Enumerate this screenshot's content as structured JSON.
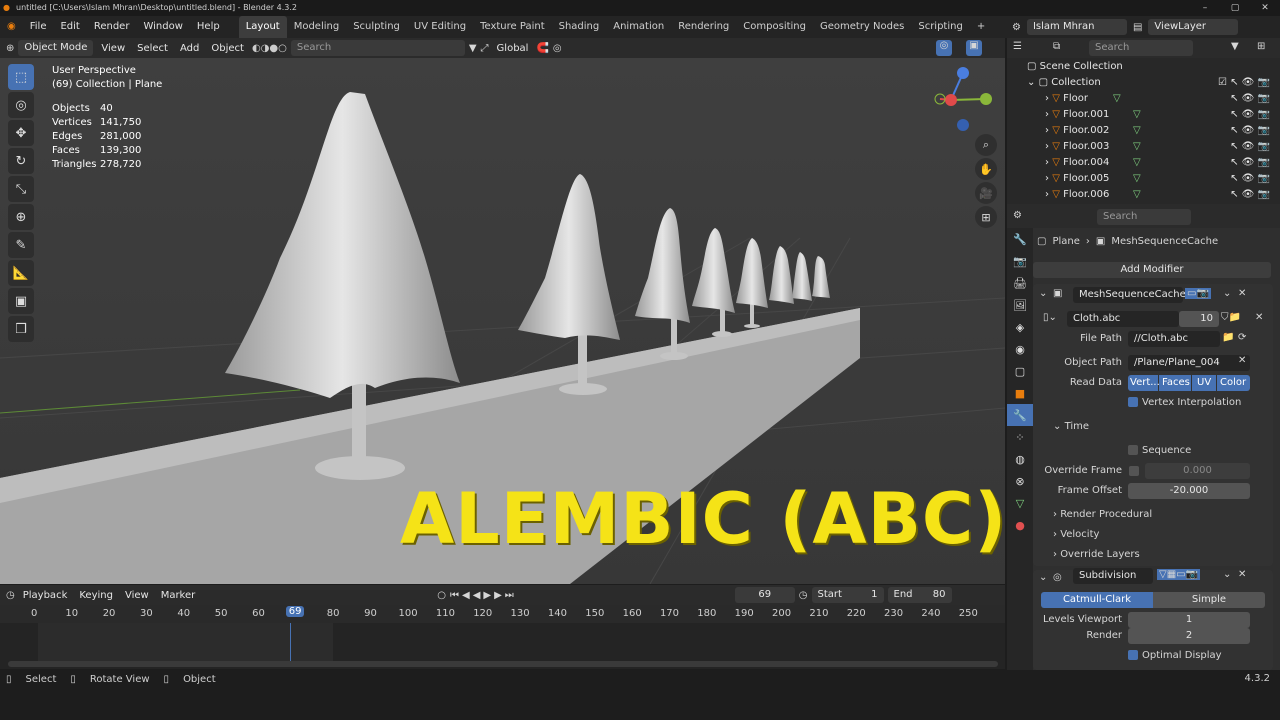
{
  "window": {
    "title": "untitled [C:\\Users\\Islam Mhran\\Desktop\\untitled.blend] - Blender 4.3.2"
  },
  "menu": {
    "items": [
      "File",
      "Edit",
      "Render",
      "Window",
      "Help"
    ]
  },
  "workspaces": [
    "Layout",
    "Modeling",
    "Sculpting",
    "UV Editing",
    "Texture Paint",
    "Shading",
    "Animation",
    "Rendering",
    "Compositing",
    "Geometry Nodes",
    "Scripting"
  ],
  "active_workspace": "Layout",
  "topright": {
    "user": "Islam Mhran",
    "viewlayer": "ViewLayer"
  },
  "viewport_header": {
    "mode": "Object Mode",
    "view": "View",
    "select": "Select",
    "add": "Add",
    "object": "Object",
    "search_placeholder": "Search",
    "orientation": "Global"
  },
  "viewport": {
    "perspective": "User Perspective",
    "collection_line": "(69) Collection | Plane",
    "stats": [
      {
        "k": "Objects",
        "v": "40"
      },
      {
        "k": "Vertices",
        "v": "141,750"
      },
      {
        "k": "Edges",
        "v": "281,000"
      },
      {
        "k": "Faces",
        "v": "139,300"
      },
      {
        "k": "Triangles",
        "v": "278,720"
      }
    ],
    "overlay_title": "ALEMBIC (ABC)"
  },
  "timeline_header": {
    "playback": "Playback",
    "keying": "Keying",
    "view": "View",
    "marker": "Marker",
    "current_frame": "69",
    "start_label": "Start",
    "start": "1",
    "end_label": "End",
    "end": "80"
  },
  "timeline_ticks": [
    "0",
    "10",
    "20",
    "30",
    "40",
    "50",
    "60",
    "69",
    "80",
    "90",
    "100",
    "110",
    "120",
    "130",
    "140",
    "150",
    "160",
    "170",
    "180",
    "190",
    "200",
    "210",
    "220",
    "230",
    "240",
    "250"
  ],
  "statusbar": {
    "select": "Select",
    "rotate": "Rotate View",
    "object": "Object",
    "version": "4.3.2"
  },
  "outliner": {
    "search_placeholder": "Search",
    "scene_collection": "Scene Collection",
    "collection": "Collection",
    "items": [
      "Floor",
      "Floor.001",
      "Floor.002",
      "Floor.003",
      "Floor.004",
      "Floor.005",
      "Floor.006"
    ]
  },
  "properties": {
    "search_placeholder": "Search",
    "breadcrumb_obj": "Plane",
    "breadcrumb_mod": "MeshSequenceCache",
    "add_modifier": "Add Modifier",
    "mod1_name": "MeshSequenceCache",
    "cache_file": "Cloth.abc",
    "cache_users": "10",
    "file_path_label": "File Path",
    "file_path": "//Cloth.abc",
    "object_path_label": "Object Path",
    "object_path": "/Plane/Plane_004",
    "read_data_label": "Read Data",
    "read_data": [
      "Vert...",
      "Faces",
      "UV",
      "Color"
    ],
    "vertex_interp": "Vertex Interpolation",
    "time_panel": "Time",
    "sequence": "Sequence",
    "override_frame_label": "Override Frame",
    "override_frame": "0.000",
    "frame_offset_label": "Frame Offset",
    "frame_offset": "-20.000",
    "render_procedural": "Render Procedural",
    "velocity": "Velocity",
    "override_layers": "Override Layers",
    "mod2_name": "Subdivision",
    "catmull": "Catmull-Clark",
    "simple": "Simple",
    "levels_viewport_label": "Levels Viewport",
    "levels_viewport": "1",
    "render_label": "Render",
    "render_level": "2",
    "optimal_display": "Optimal Display"
  }
}
